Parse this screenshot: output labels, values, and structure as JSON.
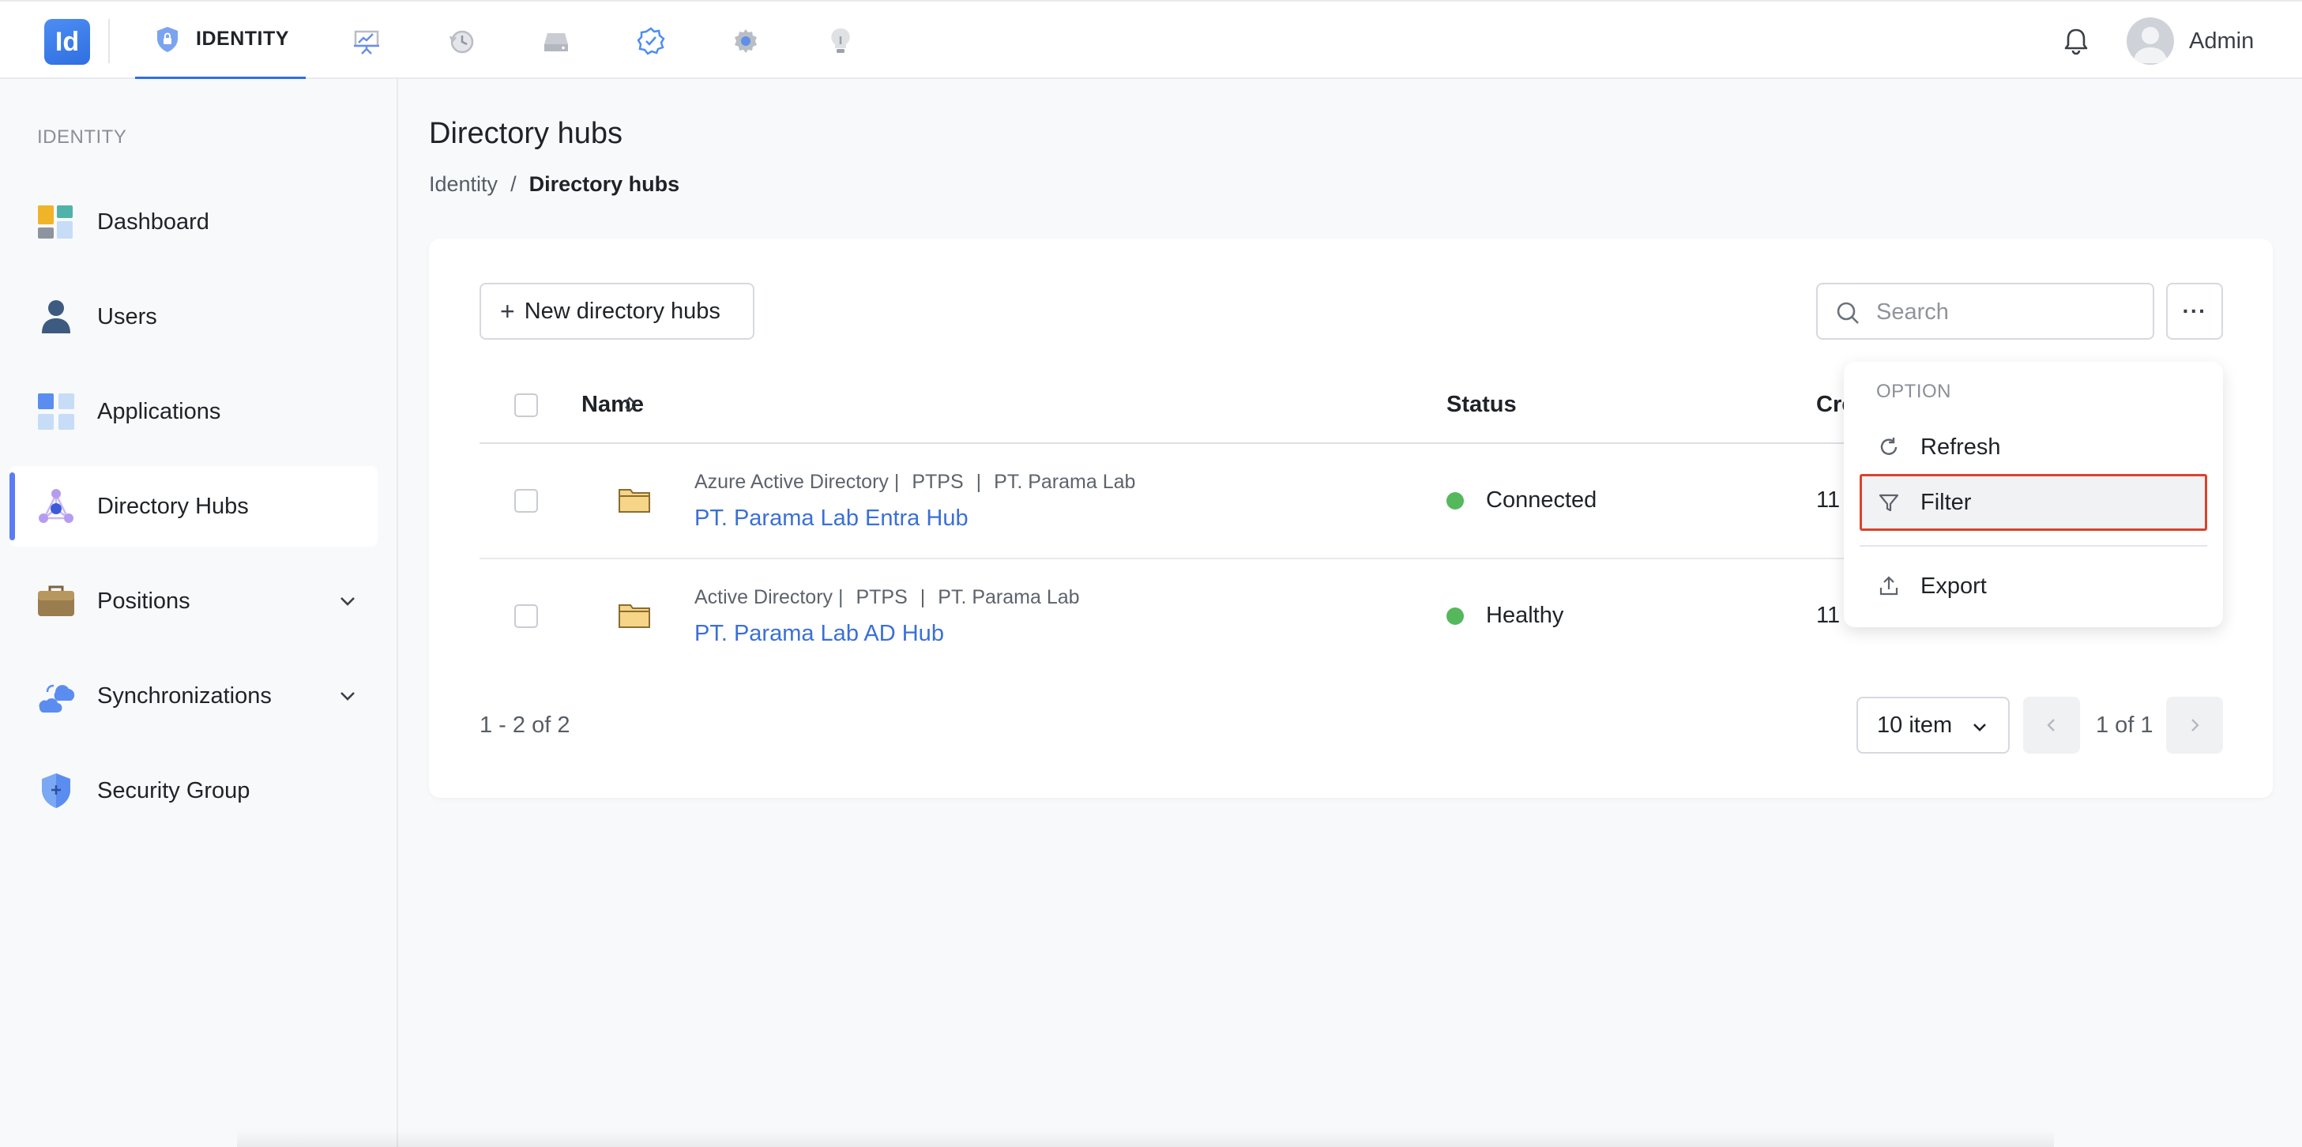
{
  "topbar": {
    "logo_text": "Id",
    "active_tab_label": "IDENTITY",
    "user_name": "Admin",
    "other_tabs": [
      "presentation-icon",
      "history-icon",
      "drive-icon",
      "badge-check-icon",
      "settings-icon",
      "bulb-icon"
    ]
  },
  "sidebar": {
    "heading": "IDENTITY",
    "items": [
      {
        "label": "Dashboard",
        "icon": "dashboard-icon"
      },
      {
        "label": "Users",
        "icon": "user-icon"
      },
      {
        "label": "Applications",
        "icon": "applications-icon"
      },
      {
        "label": "Directory Hubs",
        "icon": "directory-hub-icon",
        "active": true
      },
      {
        "label": "Positions",
        "icon": "briefcase-icon",
        "expandable": true
      },
      {
        "label": "Synchronizations",
        "icon": "cloud-sync-icon",
        "expandable": true
      },
      {
        "label": "Security Group",
        "icon": "shield-icon"
      }
    ]
  },
  "page": {
    "title": "Directory hubs",
    "breadcrumb": [
      "Identity",
      "/",
      "Directory hubs"
    ]
  },
  "toolbar": {
    "new_button_label": "New directory hubs",
    "search_placeholder": "Search",
    "more_label": "···"
  },
  "table": {
    "columns": [
      "Name",
      "Status",
      "Cre"
    ],
    "rows": [
      {
        "meta": [
          "Azure Active Directory |",
          "PTPS",
          "|",
          "PT. Parama Lab"
        ],
        "name": "PT. Parama Lab Entra Hub",
        "status": "Connected",
        "created": "11"
      },
      {
        "meta": [
          "Active Directory |",
          "PTPS",
          "|",
          "PT. Parama Lab"
        ],
        "name": "PT. Parama Lab AD Hub",
        "status": "Healthy",
        "created": "11"
      }
    ]
  },
  "footer": {
    "count": "1 - 2 of 2",
    "per_page": "10 item",
    "page_info": "1 of 1"
  },
  "dropdown": {
    "heading": "OPTION",
    "items": [
      {
        "label": "Refresh",
        "icon": "refresh-icon"
      },
      {
        "label": "Filter",
        "icon": "filter-icon",
        "highlighted": true
      },
      {
        "label": "Export",
        "icon": "export-icon"
      }
    ]
  },
  "colors": {
    "accent": "#2f6fe0",
    "link": "#3b6fd8",
    "status_ok": "#56b85c",
    "highlight_border": "#d9432c"
  }
}
